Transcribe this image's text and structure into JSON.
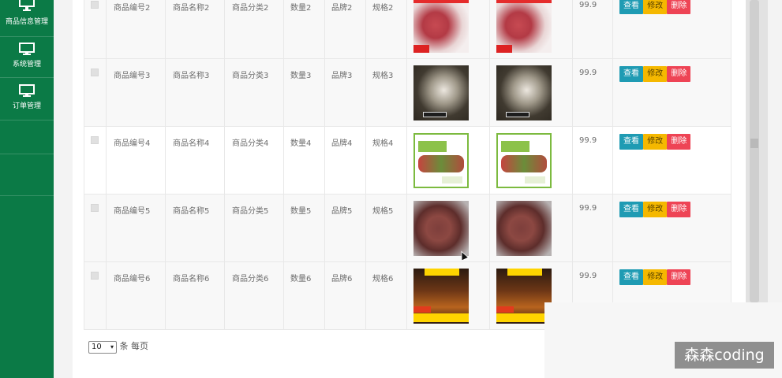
{
  "sidebar": {
    "items": [
      {
        "label": "商品信息管理",
        "icon": "monitor-icon"
      },
      {
        "label": "系统管理",
        "icon": "monitor-icon"
      },
      {
        "label": "订单管理",
        "icon": "monitor-icon"
      }
    ]
  },
  "table": {
    "rows": [
      {
        "code": "商品编号2",
        "name": "商品名称2",
        "category": "商品分类2",
        "qty": "数量2",
        "brand": "品牌2",
        "spec": "规格2",
        "image": "beef-steak-image",
        "price": "99.9"
      },
      {
        "code": "商品编号3",
        "name": "商品名称3",
        "category": "商品分类3",
        "qty": "数量3",
        "brand": "品牌3",
        "spec": "规格3",
        "image": "oyster-image",
        "price": "99.9"
      },
      {
        "code": "商品编号4",
        "name": "商品名称4",
        "category": "商品分类4",
        "qty": "数量4",
        "brand": "品牌4",
        "spec": "规格4",
        "image": "vegetable-box-image",
        "price": "99.9"
      },
      {
        "code": "商品编号5",
        "name": "商品名称5",
        "category": "商品分类5",
        "qty": "数量5",
        "brand": "品牌5",
        "spec": "规格5",
        "image": "beef-cubes-image",
        "price": "99.9"
      },
      {
        "code": "商品编号6",
        "name": "商品名称6",
        "category": "商品分类6",
        "qty": "数量6",
        "brand": "品牌6",
        "spec": "规格6",
        "image": "skewer-image",
        "price": "99.9"
      }
    ],
    "actions": {
      "view": "查看",
      "edit": "修改",
      "delete": "删除"
    }
  },
  "pager": {
    "page_size": "10",
    "suffix": "条 每页"
  },
  "watermark": "森森coding",
  "colors": {
    "sidebar": "#0b7a46",
    "view": "#1f9bb3",
    "edit": "#f5b800",
    "delete": "#ee4455"
  }
}
